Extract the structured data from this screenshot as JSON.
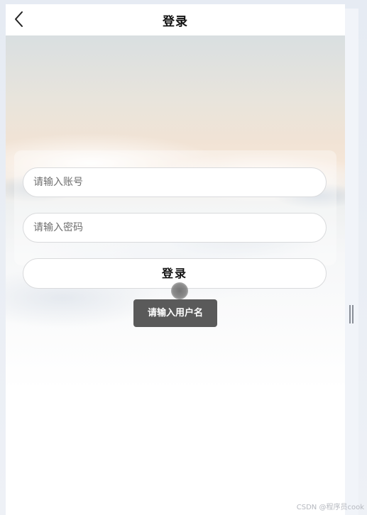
{
  "navbar": {
    "title": "登录",
    "back_icon": "chevron-left-icon"
  },
  "form": {
    "account_placeholder": "请输入账号",
    "account_value": "",
    "password_placeholder": "请输入密码",
    "password_value": "",
    "login_label": "登录"
  },
  "toast": {
    "message": "请输入用户名"
  },
  "watermark": "CSDN @程序员cook",
  "colors": {
    "page_background": "#e9eef6",
    "toast_background": "#4c4c4c",
    "field_border": "#d9dadc"
  }
}
